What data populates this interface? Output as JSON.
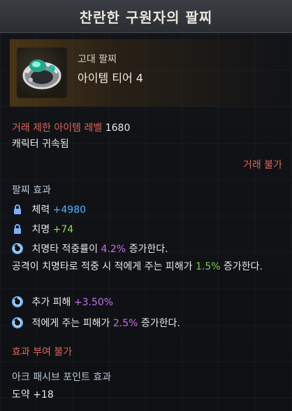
{
  "title": "찬란한 구원자의 팔찌",
  "header": {
    "grade": "고대 팔찌",
    "tier": "아이템 티어 4"
  },
  "trade": {
    "level_label": "거래 제한 아이템 레벨",
    "level_value": "1680",
    "bound": "캐릭터 귀속됨",
    "not_tradeable": "거래 불가"
  },
  "effects": {
    "heading": "팔찌 효과",
    "stats": [
      {
        "name": "체력",
        "value": "+4980"
      },
      {
        "name": "치명",
        "value": "+74"
      }
    ],
    "crit_rate": {
      "prefix": "치명타 적중률이",
      "value": "4.2%",
      "suffix": "증가한다."
    },
    "crit_damage": {
      "prefix": "공격이 치명타로 적중 시 적에게 주는 피해가",
      "value": "1.5%",
      "suffix": "증가한다."
    },
    "extra_damage": {
      "prefix": "추가 피해",
      "value": "+3.50%"
    },
    "damage_to_enemy": {
      "prefix": "적에게 주는 피해가",
      "value": "2.5%",
      "suffix": "증가한다."
    }
  },
  "enchant_disabled": "효과 부여 불가",
  "ark_passive": {
    "heading": "아크 패시브 포인트 효과",
    "line": "도약 +18"
  },
  "icons": {
    "lock": "lock-icon",
    "swirl": "swirl-icon",
    "item": "bracelet-icon"
  },
  "colors": {
    "red": "#e0645a",
    "blue": "#48b6ff",
    "green": "#8ae04a",
    "purple": "#c96df0"
  }
}
